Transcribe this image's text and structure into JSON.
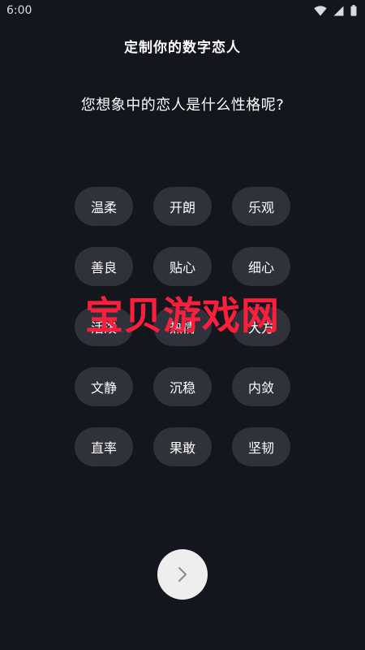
{
  "status_bar": {
    "time": "6:00"
  },
  "header": {
    "title": "定制你的数字恋人"
  },
  "question": {
    "text": "您想象中的恋人是什么性格呢?"
  },
  "traits": [
    "温柔",
    "开朗",
    "乐观",
    "善良",
    "贴心",
    "细心",
    "活泼",
    "热情",
    "大方",
    "文静",
    "沉稳",
    "内敛",
    "直率",
    "果敢",
    "坚韧"
  ],
  "watermark": {
    "text": "宝贝游戏网"
  },
  "colors": {
    "background": "#13161c",
    "chip": "#2f323b",
    "watermark": "#ff1f3d",
    "next_button": "#eeeeee"
  },
  "icons": {
    "next": "chevron-right-icon",
    "wifi": "wifi-icon",
    "signal": "signal-icon",
    "battery": "battery-icon"
  }
}
